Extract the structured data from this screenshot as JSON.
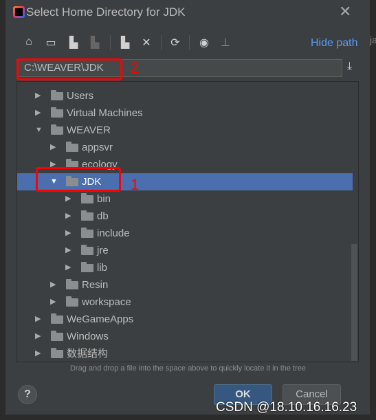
{
  "dialog": {
    "title": "Select Home Directory for JDK",
    "hide_path": "Hide path",
    "path_value": "C:\\WEAVER\\JDK",
    "hint": "Drag and drop a file into the space above to quickly locate it in the tree",
    "help": "?",
    "ok": "OK",
    "cancel": "Cancel"
  },
  "toolbar": [
    "home-icon",
    "desktop-icon",
    "project-folder-icon",
    "module-folder-icon",
    "new-folder-icon",
    "delete-icon",
    "refresh-icon",
    "show-hidden-icon",
    "add-jdk-icon"
  ],
  "annotations": {
    "one": "1",
    "two": "2"
  },
  "tree": [
    {
      "label": "Users",
      "level": 0,
      "expanded": false
    },
    {
      "label": "Virtual Machines",
      "level": 0,
      "expanded": false
    },
    {
      "label": "WEAVER",
      "level": 0,
      "expanded": true
    },
    {
      "label": "appsvr",
      "level": 1,
      "expanded": false
    },
    {
      "label": "ecology",
      "level": 1,
      "expanded": false
    },
    {
      "label": "JDK",
      "level": 1,
      "expanded": true,
      "selected": true
    },
    {
      "label": "bin",
      "level": 2,
      "expanded": false
    },
    {
      "label": "db",
      "level": 2,
      "expanded": false
    },
    {
      "label": "include",
      "level": 2,
      "expanded": false
    },
    {
      "label": "jre",
      "level": 2,
      "expanded": false
    },
    {
      "label": "lib",
      "level": 2,
      "expanded": false
    },
    {
      "label": "Resin",
      "level": 1,
      "expanded": false
    },
    {
      "label": "workspace",
      "level": 1,
      "expanded": false
    },
    {
      "label": "WeGameApps",
      "level": 0,
      "expanded": false
    },
    {
      "label": "Windows",
      "level": 0,
      "expanded": false
    },
    {
      "label": "数据结构",
      "level": 0,
      "expanded": false
    }
  ],
  "watermark": "CSDN @18.10.16.16.23",
  "colors": {
    "selection": "#4b6eaf",
    "link": "#589df6",
    "annotation": "#ff0000"
  }
}
